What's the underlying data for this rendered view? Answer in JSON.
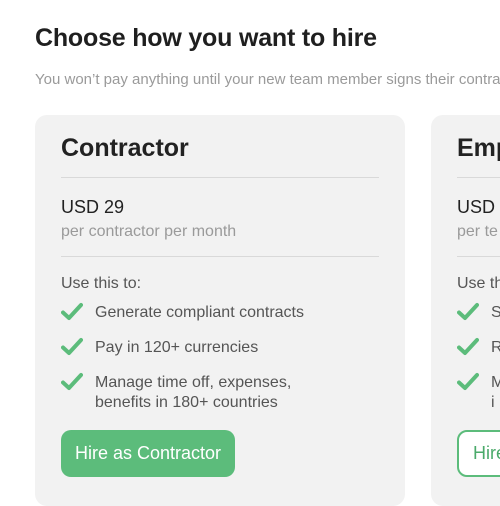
{
  "header": {
    "title": "Choose how you want to hire",
    "subtitle": "You won’t pay anything until your new team member signs their contract"
  },
  "colors": {
    "accent": "#5cbc7b",
    "card_bg": "#f2f2f2",
    "muted_text": "#9a9a9a"
  },
  "cards": [
    {
      "title": "Contractor",
      "price": "USD 29",
      "price_unit": "per contractor per month",
      "use_label": "Use this to:",
      "features": [
        "Generate compliant contracts",
        "Pay in 120+ currencies",
        "Manage time off, expenses,\nbenefits in 180+ countries"
      ],
      "button_label": "Hire as Contractor",
      "check_icon": "check-icon"
    },
    {
      "title": "Emp",
      "price": "USD",
      "price_unit": "per te",
      "use_label": "Use th",
      "features": [
        "S",
        "R",
        "M\ni"
      ],
      "button_label": "Hire",
      "check_icon": "check-icon"
    }
  ]
}
